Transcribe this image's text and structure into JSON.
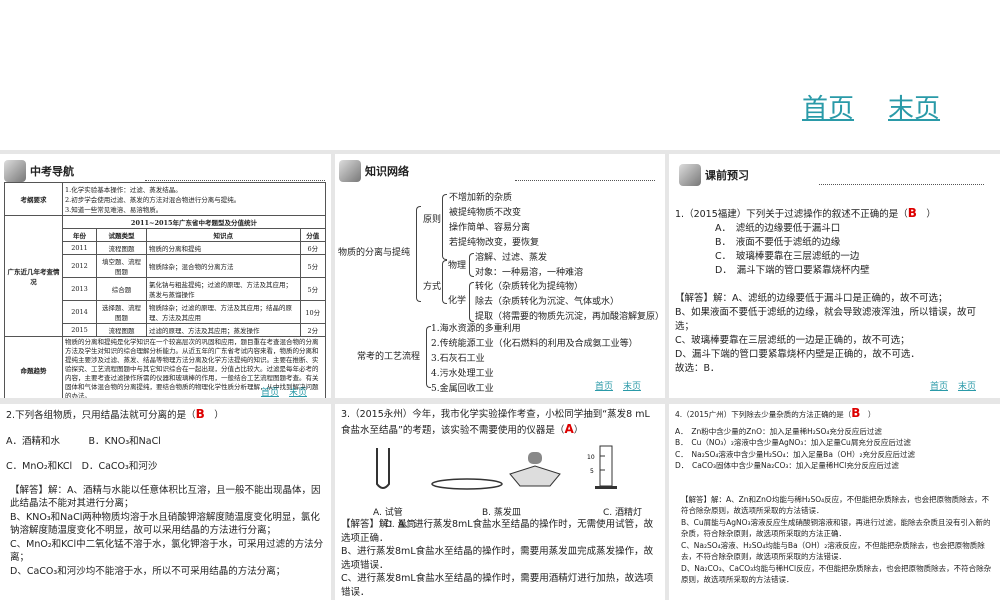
{
  "top_nav": {
    "home": "首页",
    "end": "末页"
  },
  "slide_nav": {
    "home": "首页",
    "end": "末页"
  },
  "slide1": {
    "header": "中考导航",
    "req_label": "考纲要求",
    "req": [
      "1.化学实验基本操作：过滤、蒸发结晶。",
      "2.初步学会使用过滤、蒸发的方法对混合物进行分离与提纯。",
      "3.知道一些常见难溶、易溶物质。"
    ],
    "recent_label": "广东近几年考查情况",
    "stats_title": "2011~2015年广东省中考题型及分值统计",
    "cols": [
      "年份",
      "试题类型",
      "知识点",
      "分值"
    ],
    "rows": [
      [
        "2011",
        "流程图题",
        "物质的分离和提纯",
        "6分"
      ],
      [
        "2012",
        "填空题、流程图题",
        "物质除杂；混合物的分离方法",
        "5分"
      ],
      [
        "2013",
        "综合题",
        "氯化钠与粗盐提纯；过滤的原理、方法及其应用；蒸发与蒸馏操作",
        "5分"
      ],
      [
        "2014",
        "选择题、流程图题",
        "物质除杂；过滤的原理、方法及其应用；结晶的原理、方法及其应用",
        "10分"
      ],
      [
        "2015",
        "流程图题",
        "过滤的原理、方法及其应用；蒸发操作",
        "2分"
      ]
    ],
    "trend_label": "命题趋势",
    "trend": "物质的分离和提纯是化学知识在一个较高层次的巩固和应用，题目重在考查混合物的分离方法及学生对知识的综合理解分析能力。从近五年的广东省考试内容来看，物质的分离和提纯主要涉及过滤、蒸发、结晶等物理方法分离及化学方法提纯的知识。主要在推断、实验探究、工艺流程图题中与其它知识综合在一起出现，分值占比较大。过滤是每年必考的内容，主要考查过滤操作所需的仪器和玻璃棒的作用，一般结合工艺流程图题考查。有关固体和气体混合物的分离提纯，要结合物质的物理化学性质分析理解，从中找到解决问题的办法。"
  },
  "slide2": {
    "header": "知识网络",
    "root": "物质的分离与提纯",
    "principle": "原则",
    "principles": [
      "不增加新的杂质",
      "被提纯物质不改变",
      "操作简单、容易分离",
      "若提纯物改变，要恢复"
    ],
    "method": "方式",
    "physical": "物理",
    "physical_items": [
      "溶解、过滤、蒸发",
      "对象：一种易溶，一种难溶"
    ],
    "chemical": "化学",
    "chemical_items": [
      "转化（杂质转化为提纯物）",
      "除去（杂质转化为沉淀、气体或水）",
      "提取（将需要的物质先沉淀，再加酸溶解复原）"
    ],
    "process": "常考的工艺流程",
    "process_items": [
      "1.海水资源的多重利用",
      "2.传统能源工业（化石燃料的利用及合成氨工业等）",
      "3.石灰石工业",
      "4.污水处理工业",
      "5.金属回收工业"
    ]
  },
  "slide3": {
    "header": "课前预习",
    "question": "1.（2015福建）下列关于过滤操作的叙述不正确的是（",
    "answer": "B",
    "close": "）",
    "options": [
      "A．　滤纸的边缘要低于漏斗口",
      "B．　液面不要低于滤纸的边缘",
      "C．　玻璃棒要靠在三层滤纸的一边",
      "D．　漏斗下端的管口要紧靠烧杯内壁"
    ],
    "solution": [
      "【解答】解：A、滤纸的边缘要低于漏斗口是正确的，故不可选；",
      "B、如果液面不要低于滤纸的边缘，就会导致滤液浑浊，所以错误，故可选；",
      "C、玻璃棒要靠在三层滤纸的一边是正确的，故不可选；",
      "D、漏斗下端的管口要紧靠烧杯内壁是正确的，故不可选．",
      "故选：B．"
    ]
  },
  "slide4": {
    "question": "2.下列各组物质，只用结晶法就可分离的是（",
    "answer": "B",
    "close": "）",
    "options_row1": [
      "A．酒精和水",
      "B．KNO₃和NaCl"
    ],
    "options_row2": [
      "C．MnO₂和KCl",
      "D．CaCO₃和河沙"
    ],
    "solution": [
      "【解答】解：A、酒精与水能以任意体积比互溶，且一般不能出现晶体，因此结晶法不能对其进行分离；",
      "B、KNO₃和NaCl两种物质均溶于水且硝酸钾溶解度随温度变化明显，氯化钠溶解度随温度变化不明显，故可以采用结晶的方法进行分离；",
      "C、MnO₂和KCl中二氧化锰不溶于水，氯化钾溶于水，可采用过滤的方法分离；",
      "D、CaCO₃和河沙均不能溶于水，所以不可采用结晶的方法分离；"
    ]
  },
  "slide5": {
    "question": "3.（2015永州）今年，我市化学实验操作考查，小松同学抽到“蒸发8 mL食盐水至结晶”的考题，该实验不需要使用的仪器是（",
    "answer": "A",
    "close": "）",
    "cyl_ticks": [
      "10",
      "5"
    ],
    "options": [
      "A. 试管",
      "B. 蒸发皿",
      "C. 酒精灯",
      "D. 量筒"
    ],
    "solution": [
      "【解答】解：A、进行蒸发8mL食盐水至结晶的操作时，无需使用试管，故选项正确．",
      "B、进行蒸发8mL食盐水至结晶的操作时，需要用蒸发皿完成蒸发操作，故选项错误．",
      "C、进行蒸发8mL食盐水至结晶的操作时，需要用酒精灯进行加热，故选项错误．"
    ]
  },
  "slide6": {
    "question": "4.（2015广州）下列除去少量杂质的方法正确的是（",
    "answer": "B",
    "close": "）",
    "options": [
      "A．　Zn粉中含少量的ZnO：加入足量稀H₂SO₄充分反应后过滤",
      "B．　Cu（NO₃）₂溶液中含少量AgNO₃：加入足量Cu屑充分反应后过滤",
      "C．　Na₂SO₄溶液中含少量H₂SO₄：加入足量Ba（OH）₂充分反应后过滤",
      "D．　CaCO₃固体中含少量Na₂CO₃：加入足量稀HCl充分反应后过滤"
    ],
    "solution": [
      "【解答】解：A、Zn和ZnO均能与稀H₂SO₄反应，不但能把杂质除去，也会把原物质除去，不符合除杂原则，故选项所采取的方法错误．",
      "B、Cu屑能与AgNO₃溶液反应生成硝酸铜溶液和银，再进行过滤，能除去杂质且没有引入新的杂质，符合除杂原则，故选项所采取的方法正确．",
      "C、Na₂SO₄溶液、H₂SO₄均能与Ba（OH）₂溶液反应，不但能把杂质除去，也会把原物质除去，不符合除杂原则，故选项所采取的方法错误．",
      "D、Na₂CO₃、CaCO₃均能与稀HCl反应，不但能把杂质除去，也会把原物质除去，不符合除杂原则，故选项所采取的方法错误．"
    ]
  }
}
